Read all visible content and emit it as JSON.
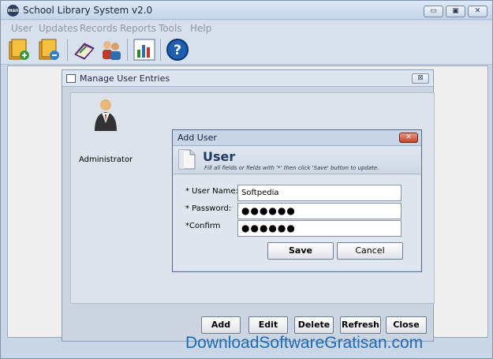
{
  "app": {
    "title": "School Library System v2.0",
    "logo_text": "msn",
    "window_controls": [
      "▭",
      "▣",
      "✕"
    ]
  },
  "menubar": [
    "User",
    "Updates",
    "Records",
    "Reports",
    "Tools",
    "Help"
  ],
  "toolbar": {
    "buttons": [
      "books-in-icon",
      "books-out-icon",
      "catalog-book-icon",
      "users-group-icon",
      "report-chart-icon",
      "help-icon"
    ],
    "help_glyph": "?"
  },
  "manage_users": {
    "title": "Manage User Entries",
    "close_glyph": "⊠",
    "users": [
      {
        "label": "Administrator",
        "icon": "administrator-user-icon"
      }
    ],
    "buttons": {
      "add": "Add",
      "edit": "Edit",
      "delete": "Delete",
      "refresh": "Refresh",
      "close": "Close"
    }
  },
  "add_user": {
    "title": "Add User",
    "close_glyph": "✕",
    "heading": "User",
    "hint": "Fill all fields or fields with '*' then click 'Save' button to update.",
    "fields": {
      "user_name": {
        "label": "* User Name:",
        "value": "Softpedia"
      },
      "password": {
        "label": "* Password:",
        "value": "●●●●●●"
      },
      "confirm": {
        "label": "*Confirm",
        "value": "●●●●●●"
      }
    },
    "buttons": {
      "save": "Save",
      "cancel": "Cancel"
    }
  },
  "watermark": "DownloadSoftwareGratisan.com",
  "colors": {
    "accent": "#203a60",
    "watermark": "#1f6bb5",
    "close_red": "#c2462b"
  }
}
